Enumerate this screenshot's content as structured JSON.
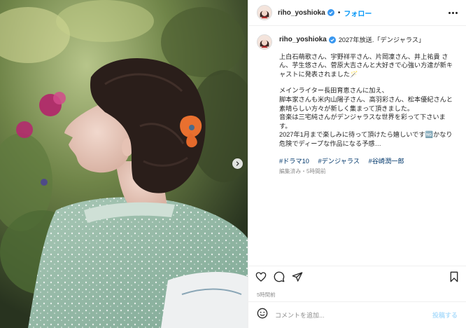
{
  "post": {
    "username": "riho_yoshioka",
    "follow_label": "フォロー",
    "dot": "•",
    "caption": {
      "title": "2027年放送.「デンジャラス」",
      "paragraphs": [
        "上白石萌歌さん、宇野祥平さん、片岡凜さん、井上祐貴 さん、芋生悠さん、菅原大吉さんと大好きで心強い方達が新キャストに発表されました🪄",
        "メインライター長田育恵さんに加え、\n脚本家さんも米内山陽子さん、高羽彩さん、松本優紀さんと素晴らしい方々が新しく集まって頂きました。\n音楽は三宅純さんがデンジャラスな世界を彩って下さいます。\n2027年1月まで楽しみに待って頂けたら嬉しいです🆖かなり危険でディープな作品になる予感…"
      ],
      "hashtags": [
        "#ドラマ10",
        "#デンジャラス",
        "#谷崎潤一郎"
      ],
      "meta": "編集済み・5時間前"
    },
    "timestamp": "5時間前",
    "comment_placeholder": "コメントを追加...",
    "post_button": "投稿する",
    "colors": {
      "link": "#0095f6",
      "hashtag": "#00376b",
      "verified": "#3897f0",
      "muted": "#8e8e8e"
    },
    "icons": [
      "more-icon",
      "heart-icon",
      "comment-icon",
      "share-icon",
      "bookmark-icon",
      "emoji-icon",
      "next-arrow-icon",
      "verified-icon"
    ]
  }
}
